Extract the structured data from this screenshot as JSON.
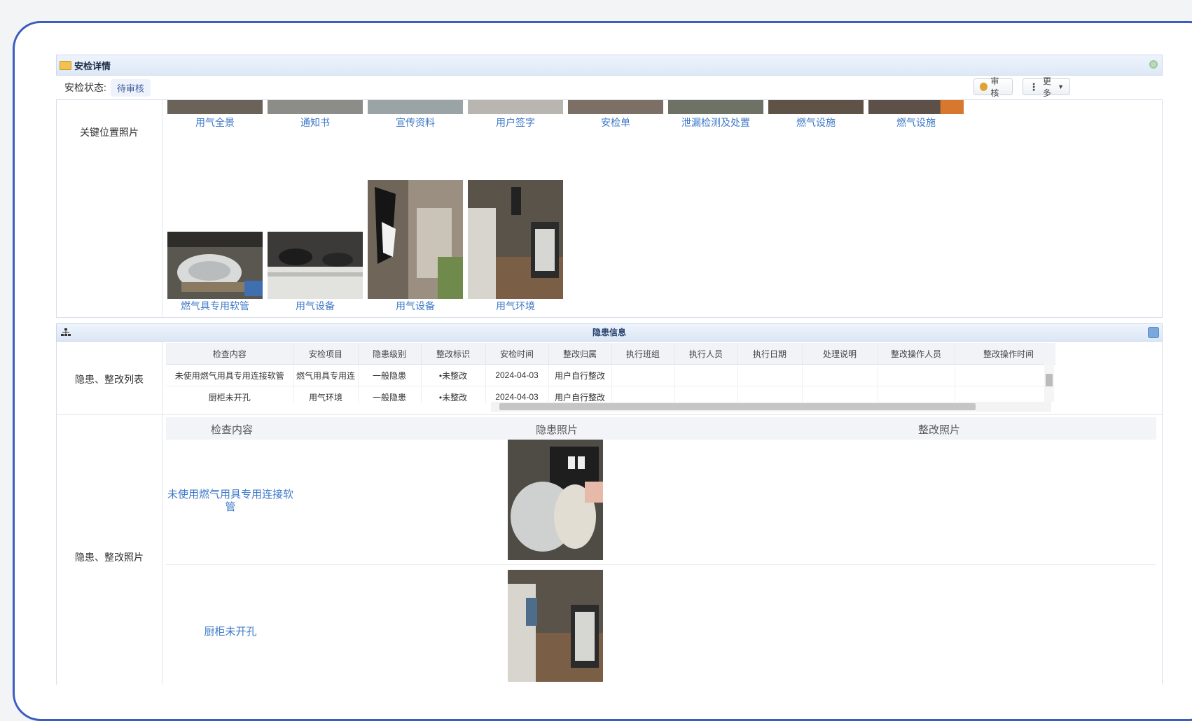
{
  "window": {
    "title": "安检详情"
  },
  "status": {
    "label": "安检状态:",
    "value": "待审核"
  },
  "toolbar": {
    "audit_label": "审核",
    "more_label": "更多"
  },
  "key_photos": {
    "label": "关键位置照片",
    "row1": [
      "用气全景",
      "通知书",
      "宣传资料",
      "用户签字",
      "安检单",
      "泄漏检测及处置",
      "燃气设施",
      "燃气设施"
    ],
    "row2": [
      "燃气具专用软管",
      "用气设备",
      "用气设备",
      "用气环境"
    ]
  },
  "hazard_panel": {
    "title": "隐患信息"
  },
  "hazard_list": {
    "label": "隐患、整改列表",
    "columns": [
      "检查内容",
      "安检项目",
      "隐患级别",
      "整改标识",
      "安检时间",
      "整改归属",
      "执行班组",
      "执行人员",
      "执行日期",
      "处理说明",
      "整改操作人员",
      "整改操作时间"
    ],
    "rows": [
      [
        "未使用燃气用具专用连接软管",
        "燃气用具专用连",
        "一般隐患",
        "•未整改",
        "2024-04-03",
        "用户自行整改",
        "",
        "",
        "",
        "",
        "",
        ""
      ],
      [
        "厨柜未开孔",
        "用气环境",
        "一般隐患",
        "•未整改",
        "2024-04-03",
        "用户自行整改",
        "",
        "",
        "",
        "",
        "",
        ""
      ]
    ]
  },
  "hazard_photos": {
    "label": "隐患、整改照片",
    "headers": [
      "检查内容",
      "隐患照片",
      "整改照片"
    ],
    "items": [
      {
        "content": "未使用燃气用具专用连接软管"
      },
      {
        "content": "厨柜未开孔"
      }
    ]
  }
}
